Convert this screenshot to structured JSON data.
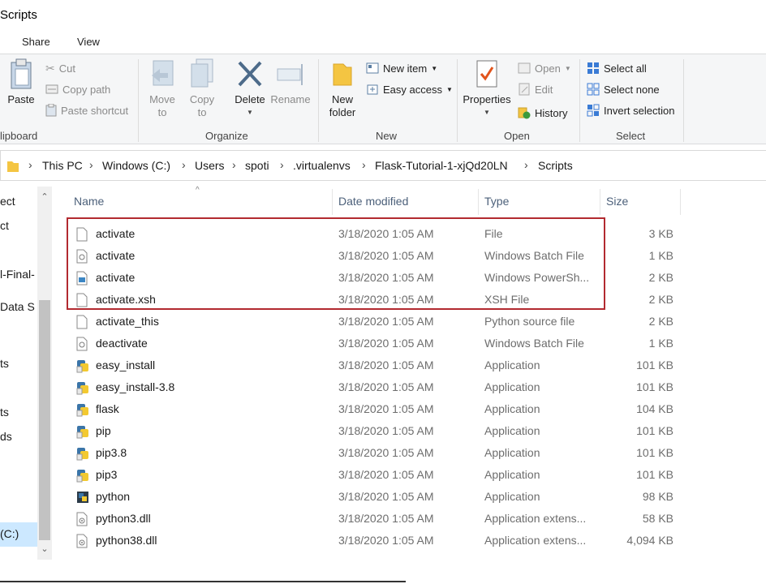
{
  "window": {
    "title": "Scripts"
  },
  "tabs": [
    {
      "label": "Share"
    },
    {
      "label": "View"
    }
  ],
  "ribbon": {
    "clipboard": {
      "label": "lipboard",
      "paste": "Paste",
      "cut": "Cut",
      "copy_path": "Copy path",
      "paste_shortcut": "Paste shortcut"
    },
    "organize": {
      "label": "Organize",
      "move_to": "Move\nto",
      "copy_to": "Copy\nto",
      "delete": "Delete",
      "rename": "Rename"
    },
    "new": {
      "label": "New",
      "new_folder": "New\nfolder",
      "new_item": "New item",
      "easy_access": "Easy access"
    },
    "open": {
      "label": "Open",
      "properties": "Properties",
      "open": "Open",
      "edit": "Edit",
      "history": "History"
    },
    "select": {
      "label": "Select",
      "select_all": "Select all",
      "select_none": "Select none",
      "invert_selection": "Invert selection"
    }
  },
  "address": {
    "crumbs": [
      "This PC",
      "Windows (C:)",
      "Users",
      "spoti",
      ".virtualenvs",
      "Flask-Tutorial-1-xjQd20LN",
      "Scripts"
    ]
  },
  "nav": {
    "items": [
      "ect",
      "ct",
      "l-Final-",
      "Data S",
      "ts",
      "ts",
      "ds",
      "(C:)"
    ]
  },
  "columns": {
    "name": "Name",
    "date": "Date modified",
    "type": "Type",
    "size": "Size"
  },
  "files": [
    {
      "name": "activate",
      "date": "3/18/2020 1:05 AM",
      "type": "File",
      "size": "3 KB",
      "icon": "blank-file-icon"
    },
    {
      "name": "activate",
      "date": "3/18/2020 1:05 AM",
      "type": "Windows Batch File",
      "size": "1 KB",
      "icon": "batch-file-icon"
    },
    {
      "name": "activate",
      "date": "3/18/2020 1:05 AM",
      "type": "Windows PowerSh...",
      "size": "2 KB",
      "icon": "powershell-file-icon"
    },
    {
      "name": "activate.xsh",
      "date": "3/18/2020 1:05 AM",
      "type": "XSH File",
      "size": "2 KB",
      "icon": "blank-file-icon"
    },
    {
      "name": "activate_this",
      "date": "3/18/2020 1:05 AM",
      "type": "Python source file",
      "size": "2 KB",
      "icon": "blank-file-icon"
    },
    {
      "name": "deactivate",
      "date": "3/18/2020 1:05 AM",
      "type": "Windows Batch File",
      "size": "1 KB",
      "icon": "batch-file-icon"
    },
    {
      "name": "easy_install",
      "date": "3/18/2020 1:05 AM",
      "type": "Application",
      "size": "101 KB",
      "icon": "python-app-icon"
    },
    {
      "name": "easy_install-3.8",
      "date": "3/18/2020 1:05 AM",
      "type": "Application",
      "size": "101 KB",
      "icon": "python-app-icon"
    },
    {
      "name": "flask",
      "date": "3/18/2020 1:05 AM",
      "type": "Application",
      "size": "104 KB",
      "icon": "python-app-icon"
    },
    {
      "name": "pip",
      "date": "3/18/2020 1:05 AM",
      "type": "Application",
      "size": "101 KB",
      "icon": "python-app-icon"
    },
    {
      "name": "pip3.8",
      "date": "3/18/2020 1:05 AM",
      "type": "Application",
      "size": "101 KB",
      "icon": "python-app-icon"
    },
    {
      "name": "pip3",
      "date": "3/18/2020 1:05 AM",
      "type": "Application",
      "size": "101 KB",
      "icon": "python-app-icon"
    },
    {
      "name": "python",
      "date": "3/18/2020 1:05 AM",
      "type": "Application",
      "size": "98 KB",
      "icon": "python-exe-icon"
    },
    {
      "name": "python3.dll",
      "date": "3/18/2020 1:05 AM",
      "type": "Application extens...",
      "size": "58 KB",
      "icon": "dll-file-icon"
    },
    {
      "name": "python38.dll",
      "date": "3/18/2020 1:05 AM",
      "type": "Application extens...",
      "size": "4,094 KB",
      "icon": "dll-file-icon"
    }
  ],
  "colors": {
    "highlight": "#b22a30",
    "header_text": "#4c607a",
    "selection": "#cce8ff"
  }
}
